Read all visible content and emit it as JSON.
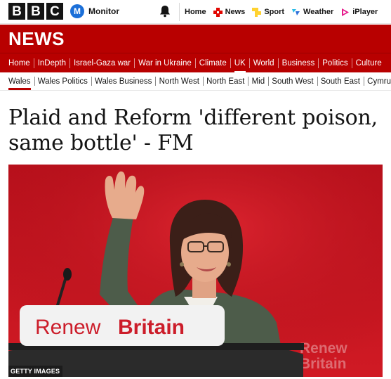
{
  "brand": {
    "letters": [
      "B",
      "B",
      "C"
    ]
  },
  "monitor": {
    "initial": "M",
    "label": "Monitor"
  },
  "top_nav": [
    {
      "label": "Home",
      "icon": "home-icon"
    },
    {
      "label": "News",
      "icon": "news-icon"
    },
    {
      "label": "Sport",
      "icon": "sport-icon"
    },
    {
      "label": "Weather",
      "icon": "weather-icon"
    },
    {
      "label": "iPlayer",
      "icon": "iplayer-icon"
    }
  ],
  "section_title": "NEWS",
  "primary_nav": [
    "Home",
    "InDepth",
    "Israel-Gaza war",
    "War in Ukraine",
    "Climate",
    "UK",
    "World",
    "Business",
    "Politics",
    "Culture"
  ],
  "primary_active": "UK",
  "secondary_nav": [
    "Wales",
    "Wales Politics",
    "Wales Business",
    "North West",
    "North East",
    "Mid",
    "South West",
    "South East",
    "Cymru"
  ],
  "secondary_active": "Wales",
  "article": {
    "headline": "Plaid and Reform 'different poison, same bottle' - FM",
    "image_credit": "GETTY IMAGES",
    "image_sign_text": {
      "word1": "Renew",
      "word2": "Britain"
    },
    "image_backdrop_text": {
      "line1": "Renew",
      "line2": "Britain"
    }
  },
  "colors": {
    "bbc_red": "#b80000",
    "monitor_blue": "#1b6fd8",
    "text": "#141414"
  }
}
